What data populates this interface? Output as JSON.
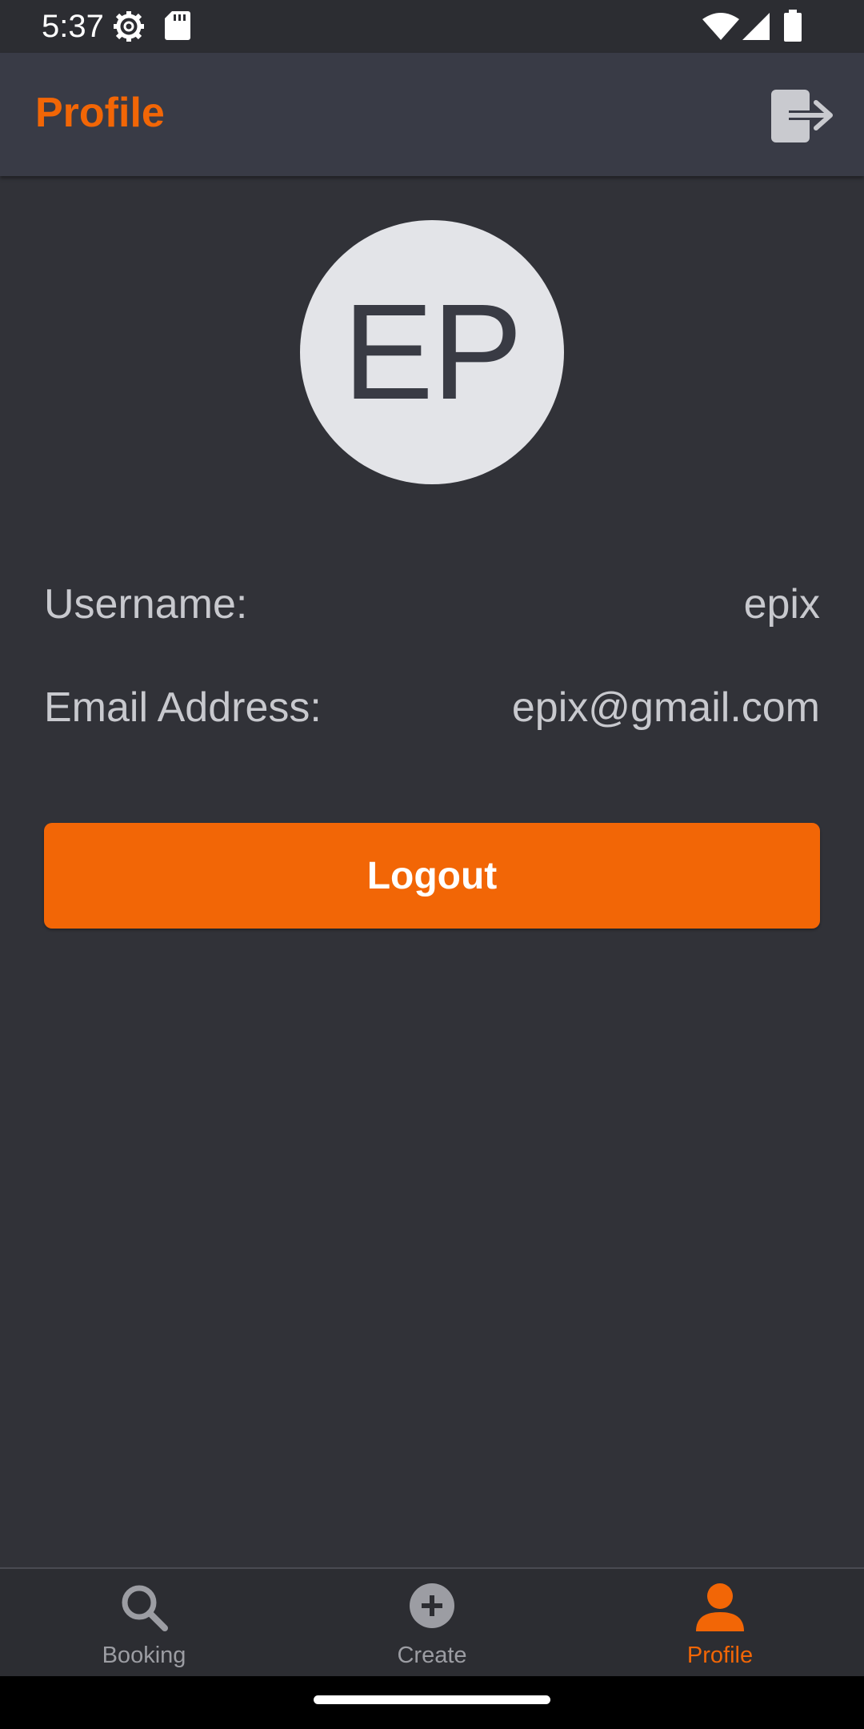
{
  "status_bar": {
    "time": "5:37",
    "icons": [
      "settings-gear-icon",
      "sd-card-icon",
      "wifi-icon",
      "cell-signal-icon",
      "battery-icon"
    ]
  },
  "app_bar": {
    "title": "Profile",
    "action_icon": "logout-icon"
  },
  "profile": {
    "initials": "EP",
    "username_label": "Username:",
    "username_value": "epix",
    "email_label": "Email Address:",
    "email_value": "epix@gmail.com"
  },
  "actions": {
    "logout_label": "Logout"
  },
  "bottom_nav": {
    "items": [
      {
        "label": "Booking",
        "icon": "search-icon",
        "active": false
      },
      {
        "label": "Create",
        "icon": "add-circle-icon",
        "active": false
      },
      {
        "label": "Profile",
        "icon": "person-icon",
        "active": true
      }
    ]
  },
  "colors": {
    "accent": "#f26606",
    "background": "#313238",
    "app_bar": "#393b46",
    "text_secondary": "#c8c9ce",
    "avatar_bg": "#e3e4e8"
  }
}
